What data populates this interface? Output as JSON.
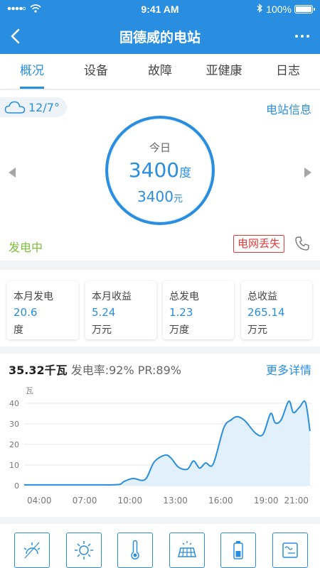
{
  "status_bar": {
    "time": "9:41 AM",
    "battery": "100%"
  },
  "nav": {
    "title": "固德威的电站"
  },
  "tabs": [
    "概况",
    "设备",
    "故障",
    "亚健康",
    "日志"
  ],
  "summary": {
    "weather": "12/7°",
    "station_info": "电站信息",
    "today_label": "今日",
    "today_energy": "3400",
    "energy_unit": "度",
    "today_income": "3400",
    "income_unit": "元",
    "gen_status": "发电中",
    "grid_status": "电网丢失"
  },
  "stats": [
    {
      "label": "本月发电",
      "value": "20.6",
      "unit": "度"
    },
    {
      "label": "本月收益",
      "value": "5.24",
      "unit": "万元"
    },
    {
      "label": "总发电",
      "value": "1.23",
      "unit": "万度"
    },
    {
      "label": "总收益",
      "value": "265.14",
      "unit": "万元"
    }
  ],
  "chart_header": {
    "power": "35.32千瓦",
    "rates": "发电率:92% PR:89%",
    "more": "更多详情"
  },
  "chart_data": {
    "type": "area",
    "ylabel": "瓦",
    "ylim": [
      0,
      40
    ],
    "yticks": [
      0,
      10,
      20,
      30,
      40
    ],
    "xlim": [
      3.0,
      22.0
    ],
    "xticks": [
      4,
      7,
      10,
      13,
      16,
      19,
      21
    ],
    "xticklabels": [
      "04:00",
      "07:00",
      "10:00",
      "13:00",
      "16:00",
      "19:00",
      "21:00"
    ],
    "grid": true,
    "color": "#2a8ee0",
    "fill": "#e2f0fb",
    "x": [
      3.0,
      7.5,
      9.2,
      9.6,
      10.2,
      11.0,
      11.6,
      12.3,
      12.7,
      13.2,
      13.8,
      14.2,
      14.6,
      15.0,
      15.5,
      16.2,
      16.7,
      17.1,
      17.6,
      18.3,
      18.8,
      19.3,
      19.6,
      20.0,
      20.5,
      20.8,
      21.2,
      21.6,
      21.9
    ],
    "y": [
      0.4,
      0.4,
      0.5,
      2.0,
      3.5,
      3.0,
      11.5,
      14.8,
      13.5,
      9.0,
      8.0,
      12.0,
      8.5,
      11.0,
      10.5,
      28.0,
      32.0,
      33.5,
      31.5,
      25.5,
      25.0,
      35.0,
      30.5,
      32.0,
      41.0,
      35.5,
      38.0,
      40.5,
      26.5
    ]
  },
  "toolbar": [
    "day-sunrise-icon",
    "sun-icon",
    "thermometer-icon",
    "solar-panel-icon",
    "battery-icon",
    "inverter-icon"
  ]
}
